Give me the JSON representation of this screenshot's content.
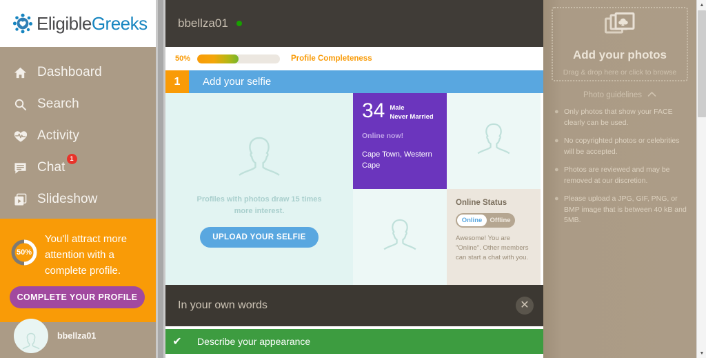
{
  "brand": {
    "name_part1": "Eligible",
    "name_part2": "Greeks",
    "logo_icon": "flower-dots-heart-icon",
    "color_dark": "#4b4b4d",
    "color_blue": "#1685c0"
  },
  "sidebar": {
    "items": [
      {
        "label": "Dashboard",
        "icon": "home-icon",
        "badge": ""
      },
      {
        "label": "Search",
        "icon": "search-icon",
        "badge": ""
      },
      {
        "label": "Activity",
        "icon": "heart-pulse-icon",
        "badge": ""
      },
      {
        "label": "Chat",
        "icon": "chat-bubble-icon",
        "badge": "1"
      },
      {
        "label": "Slideshow",
        "icon": "slideshow-icon",
        "badge": ""
      }
    ],
    "promo": {
      "percent": "50%",
      "text": "You'll attract more attention with a complete profile.",
      "button_label": "COMPLETE YOUR PROFILE",
      "accent": "#f99b07",
      "button_color": "#a1499f"
    },
    "user": {
      "name": "bbellza01",
      "avatar_icon": "person-silhouette-icon"
    }
  },
  "main": {
    "header": {
      "username": "bbellza01",
      "status_dot_color": "#18a000",
      "status_icon": "online-dot-icon"
    },
    "completeness": {
      "percent_label": "50%",
      "percent_value": 50,
      "label": "Profile Completeness",
      "accent": "#f99b07"
    },
    "step": {
      "number": "1",
      "title": "Add your selfie",
      "color": "#59a7e0",
      "number_color": "#f99b07"
    },
    "selfie_cell": {
      "placeholder_icon": "person-silhouette-icon",
      "hint": "Profiles with photos draw 15 times more interest.",
      "button_label": "UPLOAD YOUR SELFIE"
    },
    "profile_card": {
      "age": "34",
      "gender": "Male",
      "marital": "Never Married",
      "online": "Online now!",
      "location": "Cape Town, Western Cape",
      "background": "#6b35bd"
    },
    "placeholder_cells": [
      {
        "icon": "person-silhouette-icon"
      },
      {
        "icon": "person-silhouette-icon"
      }
    ],
    "online_status": {
      "title": "Online Status",
      "toggle_on_label": "Online",
      "toggle_off_label": "Offline",
      "selected": "Online",
      "description": "Awesome! You are \"Online\". Other members can start a chat with you."
    },
    "words_section": {
      "title": "In your own words",
      "close_icon": "close-icon"
    },
    "appearance_section": {
      "title": "Describe your appearance",
      "check_icon": "check-icon",
      "color": "#3d9c40"
    }
  },
  "right_panel": {
    "dropzone": {
      "icon": "photos-stack-cloud-upload-icon",
      "title": "Add your photos",
      "subtitle": "Drag & drop here or click to browse"
    },
    "guidelines_toggle": {
      "label": "Photo guidelines",
      "chevron": "chevron-up-icon",
      "chevron_glyph": "⌃"
    },
    "guidelines": [
      "Only photos that show your FACE clearly can be used.",
      "No copyrighted photos or celebrities will be accepted.",
      "Photos are reviewed and may be removed at our discretion.",
      "Please upload a JPG, GIF, PNG, or BMP image that is between 40 kB and 5MB."
    ]
  },
  "scrollbar": {
    "up_icon": "scroll-up-arrow-icon",
    "down_icon": "scroll-down-arrow-icon",
    "up_glyph": "▲",
    "down_glyph": "▼"
  }
}
